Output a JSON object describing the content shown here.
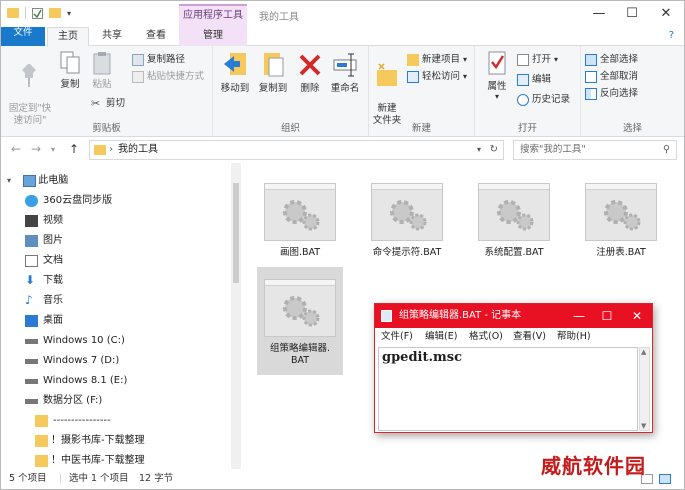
{
  "titlebar": {
    "contextual_tab": "应用程序工具",
    "window_title": "我的工具",
    "minimize": "—",
    "maximize": "☐",
    "close": "✕"
  },
  "tabs": {
    "file": "文件",
    "home": "主页",
    "share": "共享",
    "view": "查看",
    "manage": "管理",
    "help": "?"
  },
  "ribbon": {
    "clipboard": {
      "label": "剪贴板",
      "pin": "固定到\"快\n速访问\"",
      "copy": "复制",
      "paste": "粘贴",
      "copy_path": "复制路径",
      "paste_shortcut": "粘贴快捷方式",
      "cut": "剪切"
    },
    "organize": {
      "label": "组织",
      "move_to": "移动到",
      "copy_to": "复制到",
      "delete": "删除",
      "rename": "重命名"
    },
    "new": {
      "label": "新建",
      "new_folder": "新建\n文件夹",
      "new_item": "新建项目",
      "easy_access": "轻松访问"
    },
    "open": {
      "label": "打开",
      "properties": "属性",
      "open": "打开",
      "edit": "编辑",
      "history": "历史记录"
    },
    "select": {
      "label": "选择",
      "select_all": "全部选择",
      "select_none": "全部取消",
      "invert": "反向选择"
    }
  },
  "address": {
    "path": "我的工具",
    "search_placeholder": "搜索\"我的工具\""
  },
  "nav": {
    "items": [
      {
        "label": "此电脑"
      },
      {
        "label": "360云盘同步版"
      },
      {
        "label": "视频"
      },
      {
        "label": "图片"
      },
      {
        "label": "文档"
      },
      {
        "label": "下载"
      },
      {
        "label": "音乐"
      },
      {
        "label": "桌面"
      },
      {
        "label": "Windows 10 (C:)"
      },
      {
        "label": "Windows 7 (D:)"
      },
      {
        "label": "Windows 8.1 (E:)"
      },
      {
        "label": "数据分区 (F:)"
      },
      {
        "label": "----------------"
      },
      {
        "label": "！摄影书库-下载整理"
      },
      {
        "label": "！中医书库-下载整理"
      }
    ]
  },
  "files": [
    {
      "name": "画图.BAT"
    },
    {
      "name": "命令提示符.BAT"
    },
    {
      "name": "系统配置.BAT"
    },
    {
      "name": "注册表.BAT"
    },
    {
      "name": "组策略编辑器.\nBAT"
    }
  ],
  "status": {
    "count": "5 个项目",
    "selected": "选中 1 个项目",
    "size": "12 字节"
  },
  "notepad": {
    "title": "组策略编辑器.BAT - 记事本",
    "menu": {
      "file": "文件(F)",
      "edit": "编辑(E)",
      "format": "格式(O)",
      "view": "查看(V)",
      "help": "帮助(H)"
    },
    "content": "gpedit.msc"
  },
  "watermark": "威航软件园",
  "colors": {
    "accent": "#1979ca",
    "notepad_title": "#e81123",
    "context_tab": "#f3e2f7"
  }
}
